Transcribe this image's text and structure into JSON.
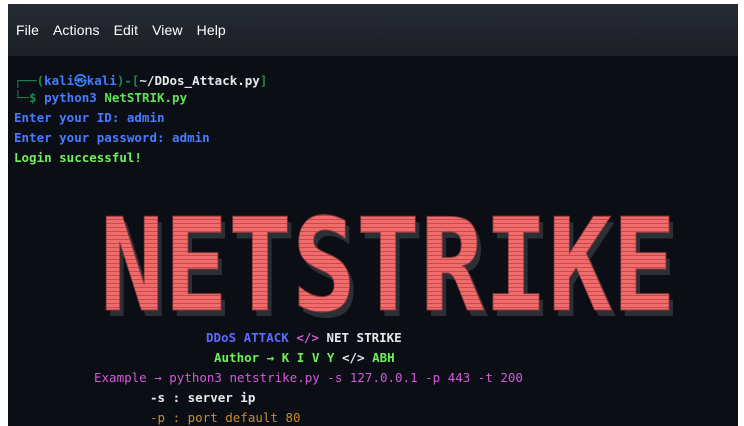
{
  "menu": [
    "File",
    "Actions",
    "Edit",
    "View",
    "Help"
  ],
  "prompt": {
    "open": "┌──(",
    "user": "kali㉿kali",
    "mid": ")-[",
    "path": "~/DDos_Attack.py",
    "close": "]",
    "lead": "└─$ ",
    "cmd_prefix": "python3 ",
    "cmd_file": "NetSTRIK.py"
  },
  "session": {
    "id_line": "Enter your ID: admin",
    "pw_line": "Enter your password: admin",
    "login": "Login successful!"
  },
  "banner": {
    "text": "NETSTRIKE",
    "color": "#f06c6c"
  },
  "info": {
    "title_a": "DDoS ATTACK",
    "title_sep": "</>",
    "title_b": "NET STRIKE",
    "author_label": "Author → K I V Y",
    "author_sep": "</>",
    "author_tail": "ABH",
    "example": "Example → python3 netstrike.py -s 127.0.0.1 -p 443 -t 200",
    "opt_s": "-s : server ip",
    "opt_p": "-p : port default 80"
  }
}
